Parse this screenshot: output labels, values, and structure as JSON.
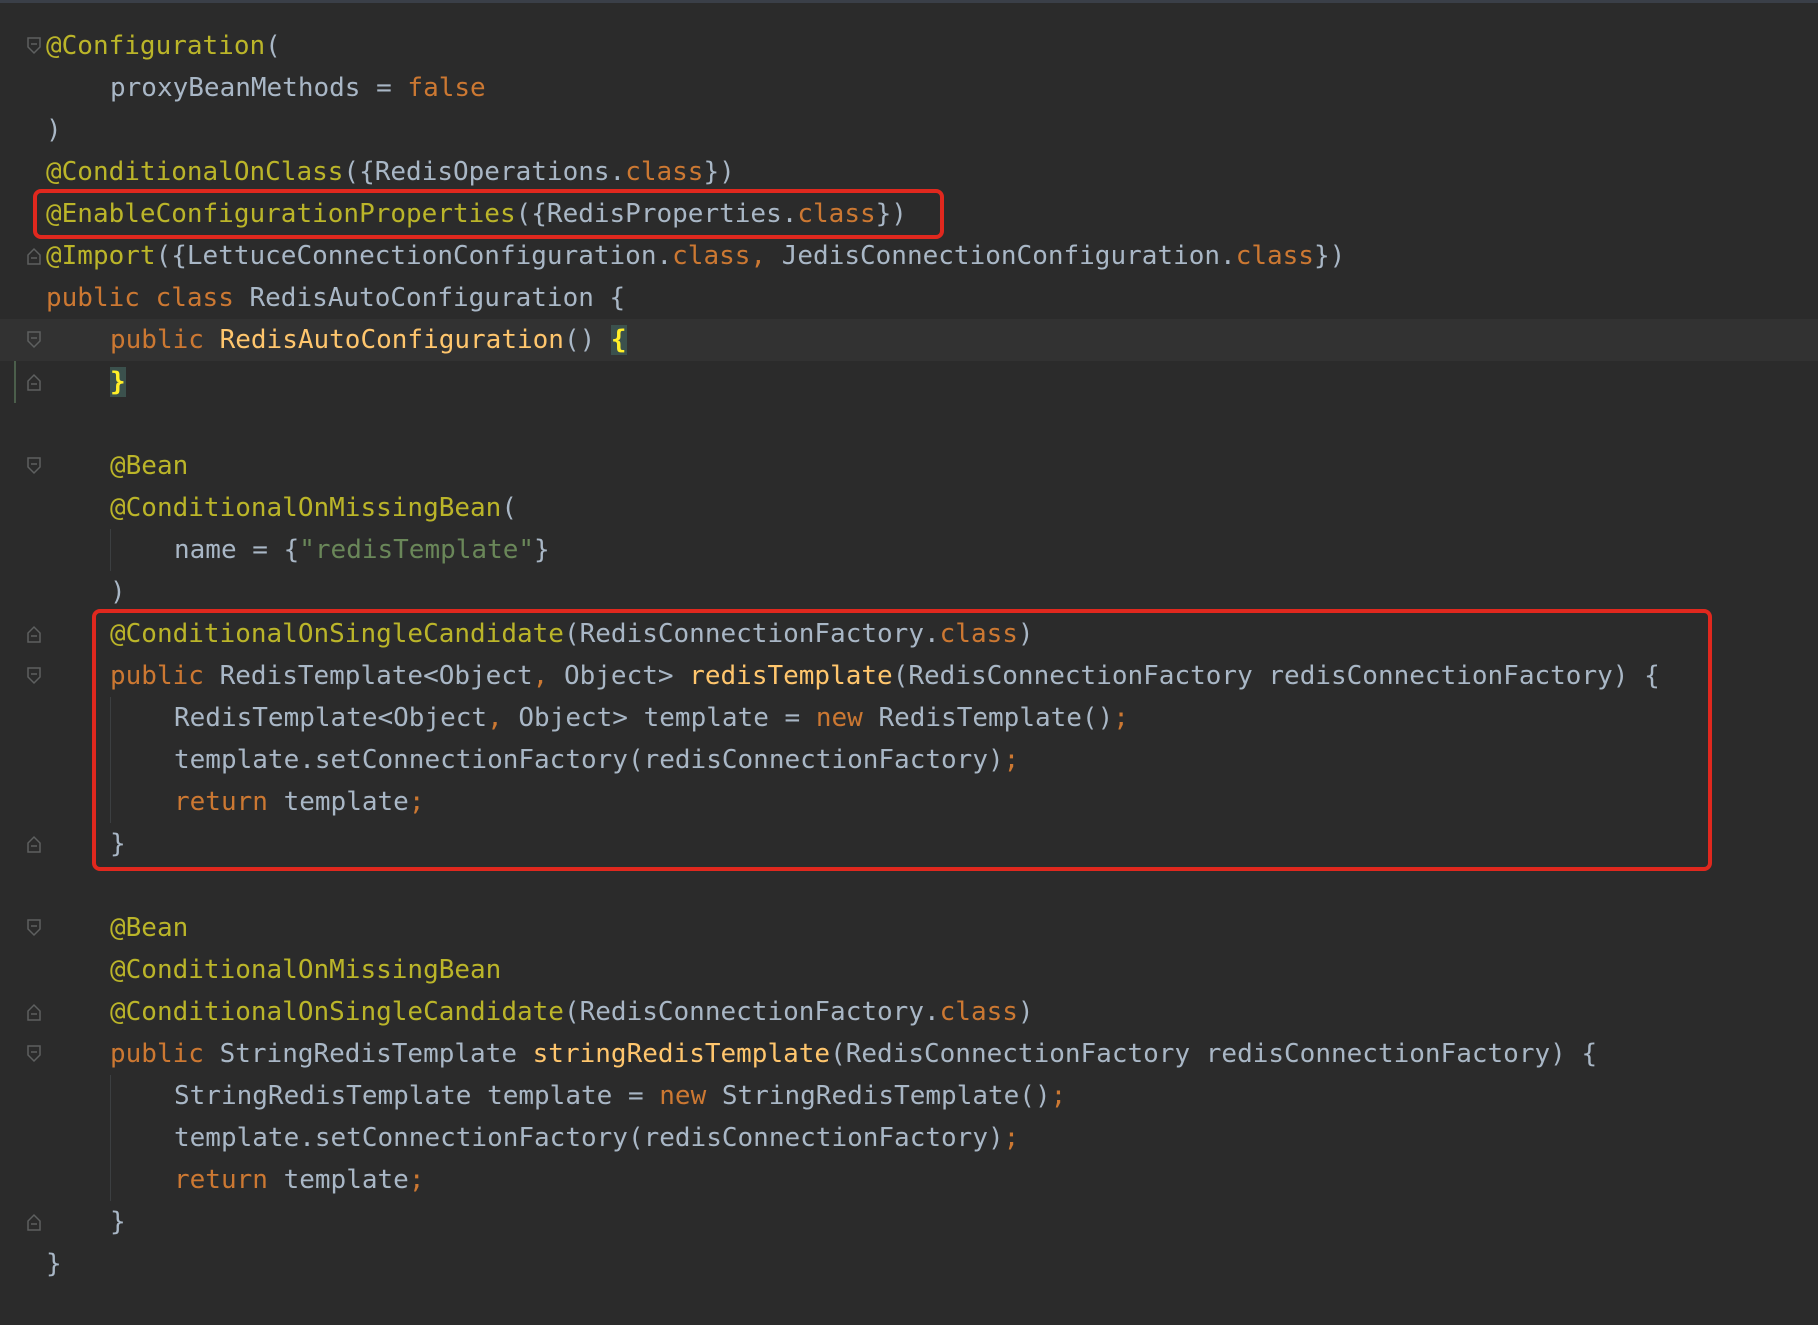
{
  "editor": {
    "lines": [
      {
        "fold": "open",
        "indent": 0,
        "tokens": [
          {
            "t": "@Configuration",
            "c": "ann"
          },
          {
            "t": "(",
            "c": ""
          }
        ]
      },
      {
        "fold": "",
        "indent": 1,
        "tokens": [
          {
            "t": "proxyBeanMethods = ",
            "c": ""
          },
          {
            "t": "false",
            "c": "kw"
          }
        ]
      },
      {
        "fold": "",
        "indent": 0,
        "tokens": [
          {
            "t": ")",
            "c": ""
          }
        ]
      },
      {
        "fold": "",
        "indent": 0,
        "tokens": [
          {
            "t": "@ConditionalOnClass",
            "c": "ann"
          },
          {
            "t": "({RedisOperations.",
            "c": ""
          },
          {
            "t": "class",
            "c": "kw"
          },
          {
            "t": "})",
            "c": ""
          }
        ]
      },
      {
        "fold": "",
        "indent": 0,
        "tokens": [
          {
            "t": "@EnableConfigurationProperties",
            "c": "ann"
          },
          {
            "t": "({RedisProperties.",
            "c": ""
          },
          {
            "t": "class",
            "c": "kw"
          },
          {
            "t": "})",
            "c": ""
          }
        ]
      },
      {
        "fold": "close",
        "indent": 0,
        "tokens": [
          {
            "t": "@Import",
            "c": "ann"
          },
          {
            "t": "({LettuceConnectionConfiguration.",
            "c": ""
          },
          {
            "t": "class",
            "c": "kw"
          },
          {
            "t": ", ",
            "c": "kw"
          },
          {
            "t": "JedisConnectionConfiguration.",
            "c": ""
          },
          {
            "t": "class",
            "c": "kw"
          },
          {
            "t": "})",
            "c": ""
          }
        ]
      },
      {
        "fold": "",
        "indent": 0,
        "tokens": [
          {
            "t": "public ",
            "c": "kw"
          },
          {
            "t": "class ",
            "c": "kw"
          },
          {
            "t": "RedisAutoConfiguration {",
            "c": ""
          }
        ]
      },
      {
        "fold": "open",
        "indent": 1,
        "current": true,
        "tokens": [
          {
            "t": "public ",
            "c": "kw"
          },
          {
            "t": "RedisAutoConfiguration",
            "c": "fn"
          },
          {
            "t": "() ",
            "c": ""
          },
          {
            "t": "{",
            "c": "brace-match"
          }
        ]
      },
      {
        "fold": "close",
        "indent": 1,
        "tokens": [
          {
            "t": "}",
            "c": "brace-match"
          }
        ]
      },
      {
        "fold": "",
        "indent": 0,
        "tokens": []
      },
      {
        "fold": "open",
        "indent": 1,
        "tokens": [
          {
            "t": "@Bean",
            "c": "ann"
          }
        ]
      },
      {
        "fold": "",
        "indent": 1,
        "tokens": [
          {
            "t": "@ConditionalOnMissingBean",
            "c": "ann"
          },
          {
            "t": "(",
            "c": ""
          }
        ]
      },
      {
        "fold": "",
        "indent": 2,
        "tokens": [
          {
            "t": "name = {",
            "c": ""
          },
          {
            "t": "\"redisTemplate\"",
            "c": "str"
          },
          {
            "t": "}",
            "c": ""
          }
        ]
      },
      {
        "fold": "",
        "indent": 1,
        "tokens": [
          {
            "t": ")",
            "c": ""
          }
        ]
      },
      {
        "fold": "close",
        "indent": 1,
        "tokens": [
          {
            "t": "@ConditionalOnSingleCandidate",
            "c": "ann"
          },
          {
            "t": "(RedisConnectionFactory.",
            "c": ""
          },
          {
            "t": "class",
            "c": "kw"
          },
          {
            "t": ")",
            "c": ""
          }
        ]
      },
      {
        "fold": "open",
        "indent": 1,
        "tokens": [
          {
            "t": "public ",
            "c": "kw"
          },
          {
            "t": "RedisTemplate<Object",
            "c": ""
          },
          {
            "t": ", ",
            "c": "kw"
          },
          {
            "t": "Object> ",
            "c": ""
          },
          {
            "t": "redisTemplate",
            "c": "fn"
          },
          {
            "t": "(RedisConnectionFactory redisConnectionFactory) {",
            "c": ""
          }
        ]
      },
      {
        "fold": "",
        "indent": 2,
        "tokens": [
          {
            "t": "RedisTemplate<Object",
            "c": ""
          },
          {
            "t": ", ",
            "c": "kw"
          },
          {
            "t": "Object> template = ",
            "c": ""
          },
          {
            "t": "new ",
            "c": "kw"
          },
          {
            "t": "RedisTemplate()",
            "c": ""
          },
          {
            "t": ";",
            "c": "kw"
          }
        ]
      },
      {
        "fold": "",
        "indent": 2,
        "tokens": [
          {
            "t": "template.setConnectionFactory(redisConnectionFactory)",
            "c": ""
          },
          {
            "t": ";",
            "c": "kw"
          }
        ]
      },
      {
        "fold": "",
        "indent": 2,
        "tokens": [
          {
            "t": "return ",
            "c": "kw"
          },
          {
            "t": "template",
            "c": ""
          },
          {
            "t": ";",
            "c": "kw"
          }
        ]
      },
      {
        "fold": "close",
        "indent": 1,
        "tokens": [
          {
            "t": "}",
            "c": ""
          }
        ]
      },
      {
        "fold": "",
        "indent": 0,
        "tokens": []
      },
      {
        "fold": "open",
        "indent": 1,
        "tokens": [
          {
            "t": "@Bean",
            "c": "ann"
          }
        ]
      },
      {
        "fold": "",
        "indent": 1,
        "tokens": [
          {
            "t": "@ConditionalOnMissingBean",
            "c": "ann"
          }
        ]
      },
      {
        "fold": "close",
        "indent": 1,
        "tokens": [
          {
            "t": "@ConditionalOnSingleCandidate",
            "c": "ann"
          },
          {
            "t": "(RedisConnectionFactory.",
            "c": ""
          },
          {
            "t": "class",
            "c": "kw"
          },
          {
            "t": ")",
            "c": ""
          }
        ]
      },
      {
        "fold": "open",
        "indent": 1,
        "tokens": [
          {
            "t": "public ",
            "c": "kw"
          },
          {
            "t": "StringRedisTemplate ",
            "c": ""
          },
          {
            "t": "stringRedisTemplate",
            "c": "fn"
          },
          {
            "t": "(RedisConnectionFactory redisConnectionFactory) {",
            "c": ""
          }
        ]
      },
      {
        "fold": "",
        "indent": 2,
        "tokens": [
          {
            "t": "StringRedisTemplate template = ",
            "c": ""
          },
          {
            "t": "new ",
            "c": "kw"
          },
          {
            "t": "StringRedisTemplate()",
            "c": ""
          },
          {
            "t": ";",
            "c": "kw"
          }
        ]
      },
      {
        "fold": "",
        "indent": 2,
        "tokens": [
          {
            "t": "template.setConnectionFactory(redisConnectionFactory)",
            "c": ""
          },
          {
            "t": ";",
            "c": "kw"
          }
        ]
      },
      {
        "fold": "",
        "indent": 2,
        "tokens": [
          {
            "t": "return ",
            "c": "kw"
          },
          {
            "t": "template",
            "c": ""
          },
          {
            "t": ";",
            "c": "kw"
          }
        ]
      },
      {
        "fold": "close",
        "indent": 1,
        "tokens": [
          {
            "t": "}",
            "c": ""
          }
        ]
      },
      {
        "fold": "",
        "indent": 0,
        "tokens": [
          {
            "t": "}",
            "c": ""
          }
        ]
      }
    ],
    "highlights": [
      {
        "name": "enable-configuration-properties",
        "from_line": 4,
        "to_line": 4
      },
      {
        "name": "redis-template-method",
        "from_line": 14,
        "to_line": 19
      }
    ],
    "colors": {
      "background": "#2b2b2b",
      "annotation": "#bbb529",
      "keyword": "#cc7832",
      "string": "#6a8759",
      "method": "#ffc66d",
      "plain": "#a9b7c6",
      "highlight_box": "#e0281e"
    }
  }
}
